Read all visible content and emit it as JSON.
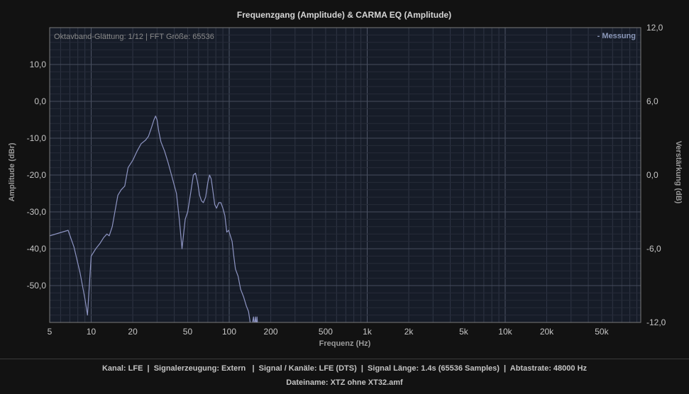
{
  "chart_data": {
    "type": "line",
    "title": "Frequenzgang (Amplitude) & CARMA EQ (Amplitude)",
    "xlabel": "Frequenz (Hz)",
    "ylabel": "Amplitude (dBr)",
    "y2label": "Verstärkung (dB)",
    "x_scale": "log",
    "xlim": [
      5,
      96000
    ],
    "ylim": [
      -60,
      20
    ],
    "y2lim": [
      -12,
      12
    ],
    "x_ticks": [
      {
        "v": 5,
        "label": "5"
      },
      {
        "v": 10,
        "label": "10"
      },
      {
        "v": 20,
        "label": "20"
      },
      {
        "v": 50,
        "label": "50"
      },
      {
        "v": 100,
        "label": "100"
      },
      {
        "v": 200,
        "label": "200"
      },
      {
        "v": 500,
        "label": "500"
      },
      {
        "v": 1000,
        "label": "1k"
      },
      {
        "v": 2000,
        "label": "2k"
      },
      {
        "v": 5000,
        "label": "5k"
      },
      {
        "v": 10000,
        "label": "10k"
      },
      {
        "v": 20000,
        "label": "20k"
      },
      {
        "v": 50000,
        "label": "50k"
      }
    ],
    "y_ticks": [
      {
        "v": 10,
        "label": "10,0"
      },
      {
        "v": 0,
        "label": "0,0"
      },
      {
        "v": -10,
        "label": "-10,0"
      },
      {
        "v": -20,
        "label": "-20,0"
      },
      {
        "v": -30,
        "label": "-30,0"
      },
      {
        "v": -40,
        "label": "-40,0"
      },
      {
        "v": -50,
        "label": "-50,0"
      }
    ],
    "y2_ticks": [
      {
        "v": 12,
        "label": "12,0"
      },
      {
        "v": 6,
        "label": "6,0"
      },
      {
        "v": 0,
        "label": "0,0"
      },
      {
        "v": -6,
        "label": "-6,0"
      },
      {
        "v": -12,
        "label": "-12,0"
      }
    ],
    "grid": true,
    "legend_position": "top-right",
    "info_text": "Oktavband-Glättung: 1/12 | FFT Größe: 65536",
    "series": [
      {
        "name": "- Messung",
        "color": "#8d94c2",
        "x": [
          5,
          6.8,
          7.5,
          8.3,
          9.0,
          9.4,
          10,
          10.8,
          11.6,
          12.3,
          13,
          13.5,
          14.2,
          15,
          15.6,
          16.5,
          17.5,
          18.5,
          20,
          21.5,
          23,
          24.8,
          26,
          27.4,
          28.5,
          29.3,
          30,
          30.8,
          32,
          34,
          36,
          38.5,
          41.5,
          43.5,
          45.5,
          48,
          50,
          52.5,
          55,
          57,
          59,
          61,
          63,
          65,
          67.5,
          70,
          72,
          74,
          76,
          78.5,
          81,
          84,
          87,
          90,
          93,
          96,
          99,
          102,
          105,
          108,
          111,
          116,
          121,
          127,
          133,
          138,
          142,
          146,
          150,
          152,
          155,
          157,
          159,
          161
        ],
        "y": [
          -36.5,
          -35,
          -39.5,
          -46.5,
          -53.5,
          -58,
          -42,
          -40,
          -38.5,
          -37,
          -36,
          -36.5,
          -34,
          -29,
          -25.5,
          -24,
          -23,
          -18,
          -16,
          -13.5,
          -11.5,
          -10.5,
          -9.5,
          -7,
          -5,
          -4,
          -5,
          -8,
          -11,
          -13.5,
          -16.5,
          -20.5,
          -25,
          -32,
          -40,
          -32,
          -30,
          -25,
          -20,
          -19.5,
          -22,
          -25.5,
          -27,
          -27.5,
          -26,
          -22,
          -20,
          -21,
          -24,
          -28,
          -29,
          -27.5,
          -27.5,
          -29,
          -31,
          -35.5,
          -35,
          -36.5,
          -38,
          -42,
          -45.5,
          -47.5,
          -51,
          -53,
          -55.5,
          -57,
          -60,
          -61,
          -58.5,
          -61,
          -58.5,
          -61,
          -58.5,
          -61
        ]
      }
    ]
  },
  "footer": {
    "line1": "Kanal: LFE  |  Signalerzeugung: Extern   |  Signal / Kanäle: LFE (DTS)  |  Signal Länge: 1.4s (65536 Samples)  |  Abtastrate: 48000 Hz",
    "line2": "Dateiname: XTZ ohne XT32.amf"
  },
  "colors": {
    "background": "#121212",
    "plot_background": "#161c28",
    "grid": "#3a4050",
    "curve": "#8d94c2",
    "legend_text": "#8a97b8"
  }
}
